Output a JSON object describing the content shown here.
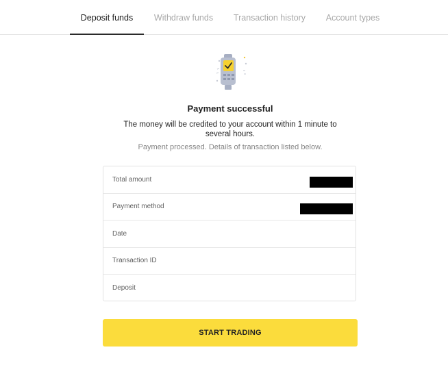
{
  "tabs": [
    {
      "label": "Deposit funds",
      "active": true
    },
    {
      "label": "Withdraw funds",
      "active": false
    },
    {
      "label": "Transaction history",
      "active": false
    },
    {
      "label": "Account types",
      "active": false
    }
  ],
  "icons": {
    "status": "payment-terminal-check-icon"
  },
  "status": {
    "title": "Payment successful",
    "message": "The money will be credited to your account within 1 minute to several hours.",
    "note": "Payment processed. Details of transaction listed below."
  },
  "details": [
    {
      "label": "Total amount",
      "value_redacted": true
    },
    {
      "label": "Payment method",
      "value_redacted": true
    },
    {
      "label": "Date"
    },
    {
      "label": "Transaction ID"
    },
    {
      "label": "Deposit"
    }
  ],
  "action": {
    "label": "START TRADING"
  },
  "colors": {
    "accent": "#fbdc3c",
    "icon_accent": "#f6d130",
    "icon_body": "#b8bfd0",
    "border": "#e2e2e2"
  }
}
